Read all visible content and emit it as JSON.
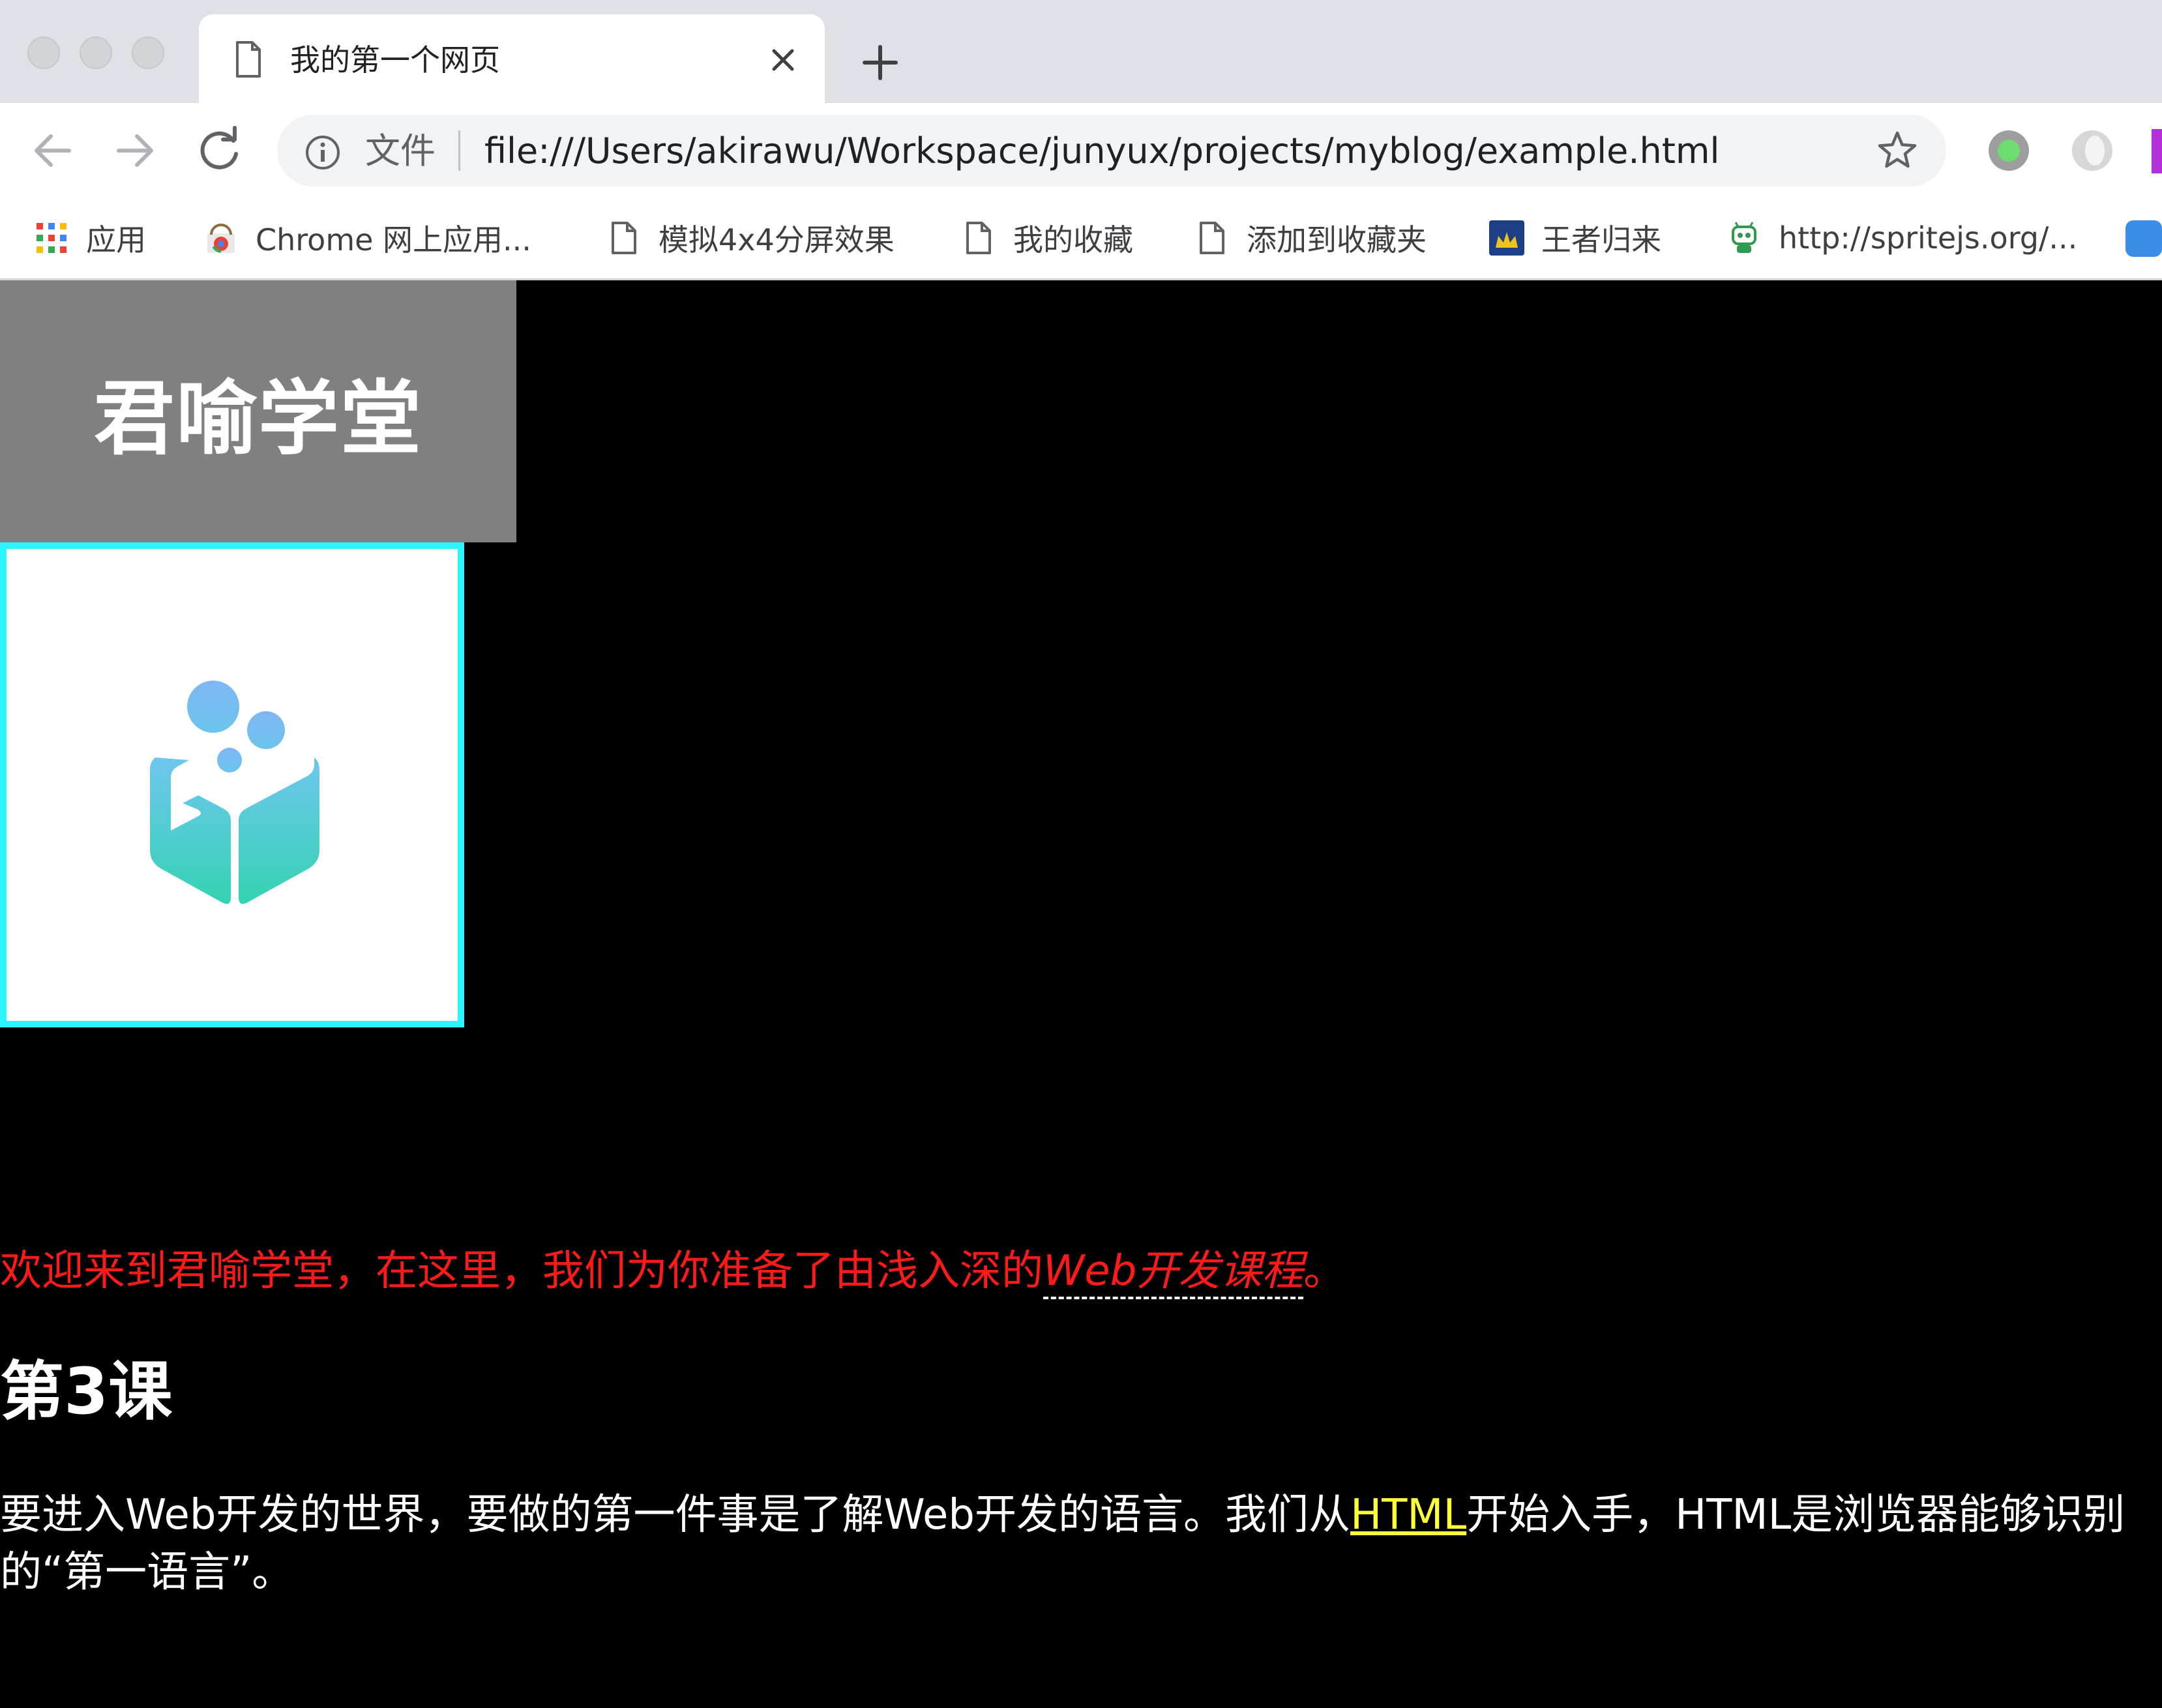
{
  "browser": {
    "tab": {
      "title": "我的第一个网页"
    },
    "address": {
      "security_label": "文件",
      "url": "file:///Users/akirawu/Workspace/junyux/projects/myblog/example.html"
    },
    "bookmarks": [
      {
        "label": "应用",
        "icon": "apps-grid-icon"
      },
      {
        "label": "Chrome 网上应用...",
        "icon": "chrome-webstore-icon"
      },
      {
        "label": "模拟4x4分屏效果",
        "icon": "page-icon"
      },
      {
        "label": "我的收藏",
        "icon": "page-icon"
      },
      {
        "label": "添加到收藏夹",
        "icon": "page-icon"
      },
      {
        "label": "王者归来",
        "icon": "crown-icon"
      },
      {
        "label": "http://spritejs.org/...",
        "icon": "robot-icon"
      }
    ],
    "colors": {
      "tabstrip": "#dee1e6",
      "omnibox": "#f1f3f4"
    }
  },
  "page": {
    "header_title": "君喻学堂",
    "intro": {
      "text": "欢迎来到君喻学堂，在这里，我们为你准备了由浅入深的",
      "course": "Web开发课程",
      "end": "。"
    },
    "lesson_title": "第3课",
    "body": {
      "before": "要进入Web开发的世界，要做的第一件事是了解Web开发的语言。我们从",
      "link": "HTML",
      "after": "开始入手，HTML是浏览器能够识别的“第一语言”。"
    },
    "colors": {
      "background": "#000000",
      "header_bg": "#808080",
      "logo_border": "#2df5ff",
      "intro": "#ff1a1a",
      "link": "#ffff33"
    }
  }
}
